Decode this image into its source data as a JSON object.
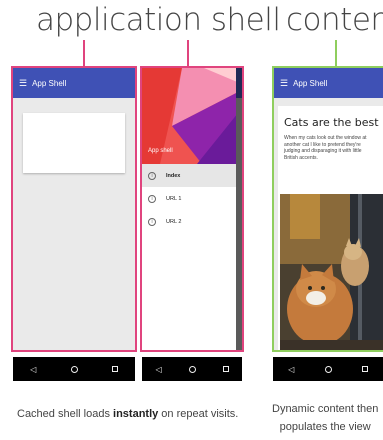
{
  "headings": {
    "shell": "application shell",
    "content": "content"
  },
  "phone_shell": {
    "appbar_title": "App Shell",
    "menu_icon": "hamburger-menu-icon"
  },
  "phone_drawer": {
    "header_title": "App shell",
    "items": [
      {
        "label": "Index",
        "active": true
      },
      {
        "label": "URL 1",
        "active": false
      },
      {
        "label": "URL 2",
        "active": false
      }
    ],
    "info_glyph": "i"
  },
  "phone_content": {
    "appbar_title": "App Shell",
    "title": "Cats are the best",
    "text": "When my cats look out the window at another cat I like to pretend they're judging and disparaging it with little British accents."
  },
  "navbar": {
    "back_icon": "◁",
    "home_icon": "home-circle-icon",
    "recent_icon": "recent-square-icon"
  },
  "captions": {
    "left_pre": "Cached shell loads ",
    "left_bold": "instantly",
    "left_post": " on repeat visits.",
    "right_line1": "Dynamic content then",
    "right_line2": "populates the view"
  },
  "colors": {
    "shell_outline": "#e0447e",
    "content_outline": "#8fce5e",
    "appbar": "#3f51b5",
    "drawer_header": "#ef5350"
  }
}
